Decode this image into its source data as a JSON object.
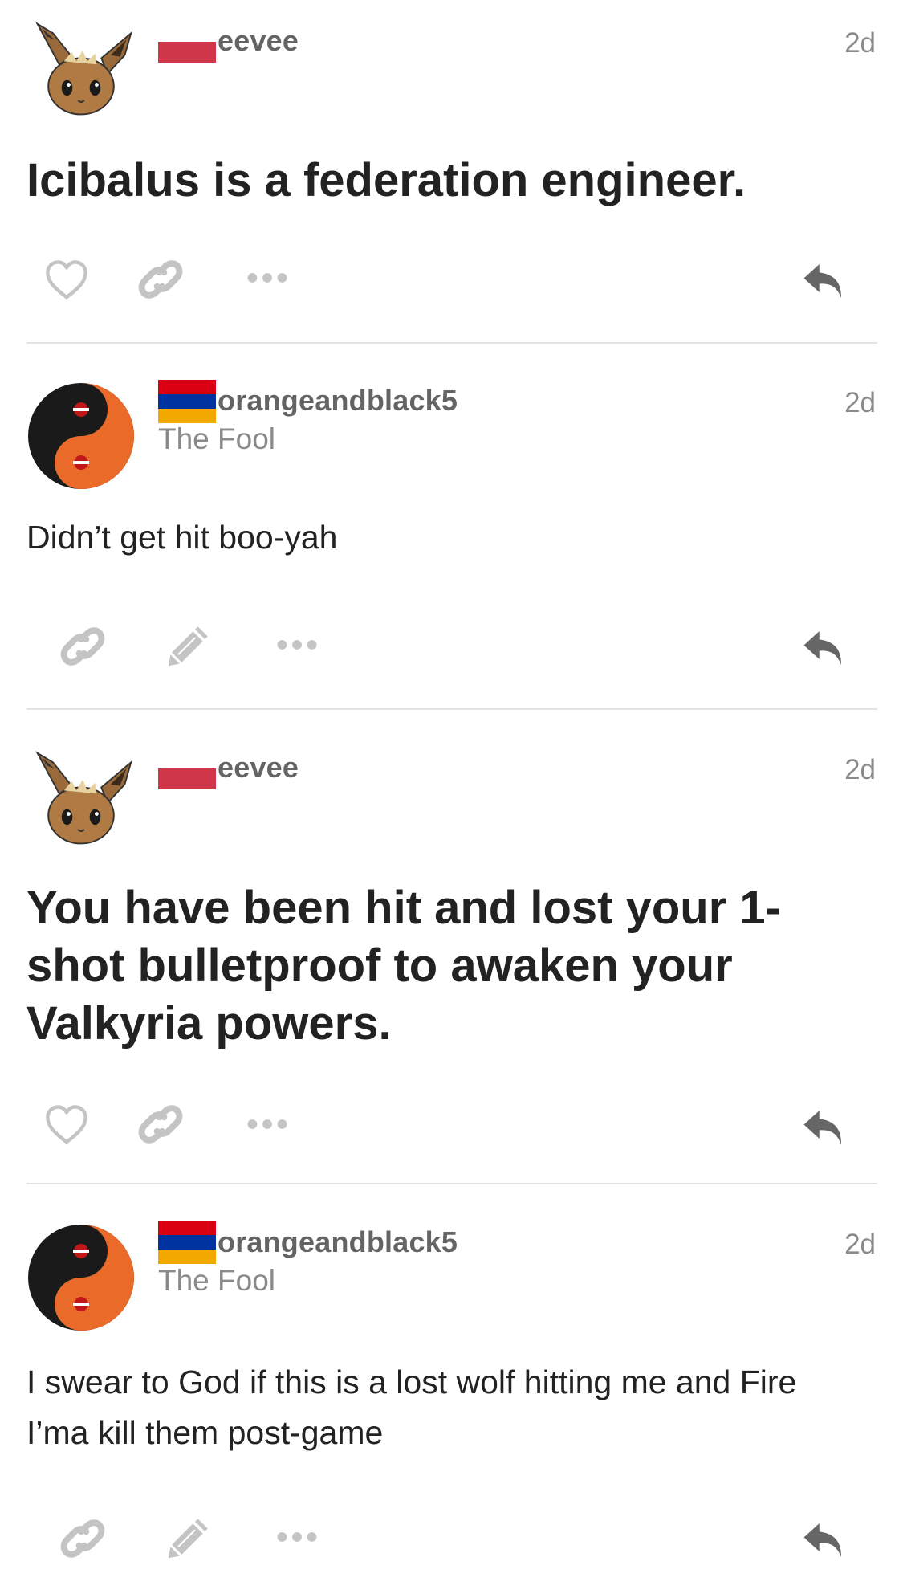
{
  "colors": {
    "text": "#222222",
    "muted": "#8a8a8a",
    "username": "#646464",
    "icon": "#c4c4c4",
    "reply_icon": "#666666",
    "divider": "#e4e4e4",
    "flag_red": "#d0364a",
    "armenia_red": "#d90012",
    "armenia_blue": "#0033a0",
    "armenia_orange": "#f2a800"
  },
  "posts": [
    {
      "username": "eevee",
      "user_title": "",
      "time": "2d",
      "avatar_icon": "eevee-avatar-icon",
      "flag_icon": "red-flag-icon",
      "body": "Icibalus is a federation engineer.",
      "actions": [
        "heart-icon",
        "link-icon",
        "more-icon",
        "reply-icon"
      ]
    },
    {
      "username": "orangeandblack5",
      "user_title": "The Fool",
      "time": "2d",
      "avatar_icon": "yin-yang-avatar-icon",
      "flag_icon": "armenia-flag-icon",
      "body": "Didn’t get hit boo-yah",
      "actions": [
        "link-icon",
        "edit-icon",
        "more-icon",
        "reply-icon"
      ]
    },
    {
      "username": "eevee",
      "user_title": "",
      "time": "2d",
      "avatar_icon": "eevee-avatar-icon",
      "flag_icon": "red-flag-icon",
      "body": "You have been hit and lost your 1-shot bulletproof to awaken your Valkyria powers.",
      "body_lines": [
        "You have been hit and lost your 1-",
        "shot bulletproof to awaken your",
        "Valkyria powers."
      ],
      "actions": [
        "heart-icon",
        "link-icon",
        "more-icon",
        "reply-icon"
      ]
    },
    {
      "username": "orangeandblack5",
      "user_title": "The Fool",
      "time": "2d",
      "avatar_icon": "yin-yang-avatar-icon",
      "flag_icon": "armenia-flag-icon",
      "body": "I swear to God if this is a lost wolf hitting me and Fire I’ma kill them post-game",
      "body_lines": [
        "I swear to God if this is a lost wolf hitting me and Fire",
        "I’ma kill them post-game"
      ],
      "actions": [
        "link-icon",
        "edit-icon",
        "more-icon",
        "reply-icon"
      ]
    }
  ]
}
